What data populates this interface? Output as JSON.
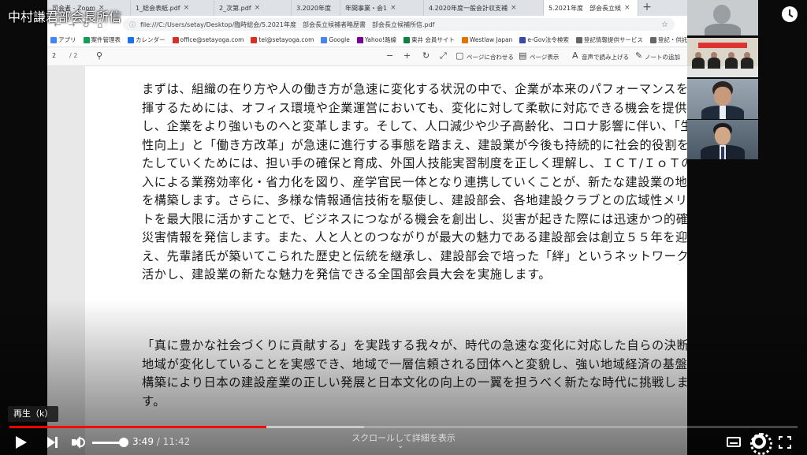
{
  "video": {
    "title": "中村謙君部会長所信",
    "tooltip": "再生（k）",
    "time_current": "3:49",
    "time_separator": " / ",
    "time_total": "11:42",
    "progress_fraction": 0.326,
    "buffer_fraction": 0.45,
    "volume_fraction": 0.85,
    "scroll_hint": "スクロールして詳細を表示",
    "accent_color": "#ff0000"
  },
  "browser": {
    "tabs": [
      {
        "label": "司会者 - Zoom"
      },
      {
        "label": "1_総会表紙.pdf"
      },
      {
        "label": "2_次第.pdf"
      },
      {
        "label": "3.2020年度"
      },
      {
        "label": "年間事業・会1"
      },
      {
        "label": "4.2020年度一般会計収支補"
      },
      {
        "label": "5.2021年度　部会長立候"
      }
    ],
    "url": "file:///C:/Users/setay/Desktop/臨時総会/5.2021年度　部会長立候補者略歴書　部会長立候補所信.pdf",
    "bookmarks": [
      {
        "label": "アプリ",
        "color": "#4285f4"
      },
      {
        "label": "案件管理表",
        "color": "#0f9d58"
      },
      {
        "label": "カレンダー",
        "color": "#1a73e8"
      },
      {
        "label": "office@setayoga.com",
        "color": "#d93025"
      },
      {
        "label": "tel@setayoga.com",
        "color": "#d93025"
      },
      {
        "label": "Google",
        "color": "#4285f4"
      },
      {
        "label": "Yahoo!路線",
        "color": "#7b0099"
      },
      {
        "label": "東井 会員サイト",
        "color": "#0b8043"
      },
      {
        "label": "Westlaw Japan",
        "color": "#e37400"
      },
      {
        "label": "e-Gov法令検索",
        "color": "#3949ab"
      },
      {
        "label": "登記情報提供サービス",
        "color": "#666666"
      },
      {
        "label": "登記・供託オンライン申",
        "color": "#666666"
      },
      {
        "label": "デスクトップ",
        "color": "#f4b400"
      }
    ]
  },
  "pdf": {
    "page_current": "2",
    "page_total": "/ 2",
    "toolbar": {
      "fit_page": "ページに合わせる",
      "page_view": "ページ表示",
      "read_aloud": "音声で読み上げる",
      "notes": "ノートの追加"
    },
    "paragraph1": "まずは、組織の在り方や人の働き方が急速に変化する状況の中で、企業が本来のパフォーマンスを発揮するためには、オフィス環境や企業運営においても、変化に対して柔軟に対応できる機会を提供し、企業をより強いものへと変革します。そして、人口減少や少子高齢化、コロナ影響に伴い、「生産性向上」と「働き方改革」が急速に進行する事態を踏まえ、建設業が今後も持続的に社会的役割を果たしていくためには、担い手の確保と育成、外国人技能実習制度を正しく理解し、ＩＣＴ/ＩｏＴの導入による業務効率化・省力化を図り、産学官民一体となり連携していくことが、新たな建設業の地盤を構築します。さらに、多様な情報通信技術を駆使し、建設部会、各地建設クラブとの広域性メリットを最大限に活かすことで、ビジネスにつながる機会を創出し、災害が起きた際には迅速かつ的確な災害情報を発信します。また、人と人とのつながりが最大の魅力である建設部会は創立５５年を迎え、先輩諸氏が築いてこられた歴史と伝統を継承し、建設部会で培った「絆」というネットワークを活かし、建設業の新たな魅力を発信できる全国部会員大会を実施します。",
    "paragraph2": "「真に豊かな社会づくりに貢献する」を実践する我々が、時代の急速な変化に対応した自らの決断に地域が変化していることを実感でき、地域で一層信頼される団体へと変貌し、強い地域経済の基盤の構築により日本の建設産業の正しい発展と日本文化の向上の一翼を担うべく新たな時代に挑戦します。"
  }
}
